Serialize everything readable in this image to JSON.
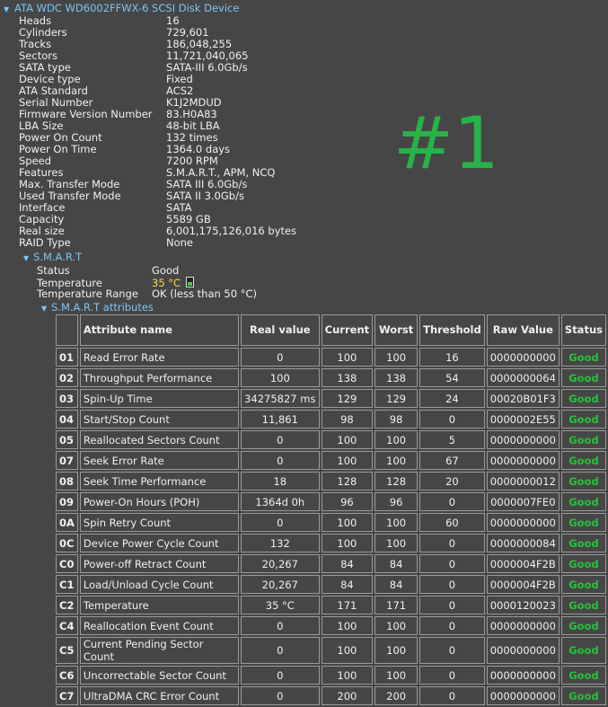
{
  "device": {
    "title": "ATA WDC WD6002FFWX-6 SCSI Disk Device"
  },
  "properties": [
    {
      "key": "Heads",
      "value": "16"
    },
    {
      "key": "Cylinders",
      "value": "729,601"
    },
    {
      "key": "Tracks",
      "value": "186,048,255"
    },
    {
      "key": "Sectors",
      "value": "11,721,040,065"
    },
    {
      "key": "SATA type",
      "value": "SATA-III 6.0Gb/s"
    },
    {
      "key": "Device type",
      "value": "Fixed"
    },
    {
      "key": "ATA Standard",
      "value": "ACS2"
    },
    {
      "key": "Serial Number",
      "value": "K1J2MDUD"
    },
    {
      "key": "Firmware Version Number",
      "value": "83.H0A83"
    },
    {
      "key": "LBA Size",
      "value": "48-bit LBA"
    },
    {
      "key": "Power On Count",
      "value": "132 times"
    },
    {
      "key": "Power On Time",
      "value": "1364.0 days"
    },
    {
      "key": "Speed",
      "value": "7200 RPM"
    },
    {
      "key": "Features",
      "value": "S.M.A.R.T., APM, NCQ"
    },
    {
      "key": "Max. Transfer Mode",
      "value": "SATA III 6.0Gb/s"
    },
    {
      "key": "Used Transfer Mode",
      "value": "SATA II 3.0Gb/s"
    },
    {
      "key": "Interface",
      "value": "SATA"
    },
    {
      "key": "Capacity",
      "value": "5589 GB"
    },
    {
      "key": "Real size",
      "value": "6,001,175,126,016 bytes"
    },
    {
      "key": "RAID Type",
      "value": "None"
    }
  ],
  "overlay_label": "#1",
  "smart": {
    "title": "S.M.A.R.T",
    "status_key": "Status",
    "status_value": "Good",
    "temperature_key": "Temperature",
    "temperature_value": "35 °C",
    "range_key": "Temperature Range",
    "range_value": "OK (less than 50 °C)",
    "attrs_title": "S.M.A.R.T attributes",
    "columns": {
      "name": "Attribute name",
      "real": "Real value",
      "current": "Current",
      "worst": "Worst",
      "threshold": "Threshold",
      "raw": "Raw Value",
      "status": "Status"
    },
    "rows": [
      {
        "id": "01",
        "name": "Read Error Rate",
        "real": "0",
        "current": "100",
        "worst": "100",
        "threshold": "16",
        "raw": "0000000000",
        "status": "Good"
      },
      {
        "id": "02",
        "name": "Throughput Performance",
        "real": "100",
        "current": "138",
        "worst": "138",
        "threshold": "54",
        "raw": "0000000064",
        "status": "Good"
      },
      {
        "id": "03",
        "name": "Spin-Up Time",
        "real": "34275827 ms",
        "current": "129",
        "worst": "129",
        "threshold": "24",
        "raw": "00020B01F3",
        "status": "Good"
      },
      {
        "id": "04",
        "name": "Start/Stop Count",
        "real": "11,861",
        "current": "98",
        "worst": "98",
        "threshold": "0",
        "raw": "0000002E55",
        "status": "Good"
      },
      {
        "id": "05",
        "name": "Reallocated Sectors Count",
        "real": "0",
        "current": "100",
        "worst": "100",
        "threshold": "5",
        "raw": "0000000000",
        "status": "Good"
      },
      {
        "id": "07",
        "name": "Seek Error Rate",
        "real": "0",
        "current": "100",
        "worst": "100",
        "threshold": "67",
        "raw": "0000000000",
        "status": "Good"
      },
      {
        "id": "08",
        "name": "Seek Time Performance",
        "real": "18",
        "current": "128",
        "worst": "128",
        "threshold": "20",
        "raw": "0000000012",
        "status": "Good"
      },
      {
        "id": "09",
        "name": "Power-On Hours (POH)",
        "real": "1364d 0h",
        "current": "96",
        "worst": "96",
        "threshold": "0",
        "raw": "0000007FE0",
        "status": "Good"
      },
      {
        "id": "0A",
        "name": "Spin Retry Count",
        "real": "0",
        "current": "100",
        "worst": "100",
        "threshold": "60",
        "raw": "0000000000",
        "status": "Good"
      },
      {
        "id": "0C",
        "name": "Device Power Cycle Count",
        "real": "132",
        "current": "100",
        "worst": "100",
        "threshold": "0",
        "raw": "0000000084",
        "status": "Good"
      },
      {
        "id": "C0",
        "name": "Power-off Retract Count",
        "real": "20,267",
        "current": "84",
        "worst": "84",
        "threshold": "0",
        "raw": "0000004F2B",
        "status": "Good"
      },
      {
        "id": "C1",
        "name": "Load/Unload Cycle Count",
        "real": "20,267",
        "current": "84",
        "worst": "84",
        "threshold": "0",
        "raw": "0000004F2B",
        "status": "Good"
      },
      {
        "id": "C2",
        "name": "Temperature",
        "real": "35 °C",
        "current": "171",
        "worst": "171",
        "threshold": "0",
        "raw": "0000120023",
        "status": "Good"
      },
      {
        "id": "C4",
        "name": "Reallocation Event Count",
        "real": "0",
        "current": "100",
        "worst": "100",
        "threshold": "0",
        "raw": "0000000000",
        "status": "Good"
      },
      {
        "id": "C5",
        "name": "Current Pending Sector Count",
        "real": "0",
        "current": "100",
        "worst": "100",
        "threshold": "0",
        "raw": "0000000000",
        "status": "Good"
      },
      {
        "id": "C6",
        "name": "Uncorrectable Sector Count",
        "real": "0",
        "current": "100",
        "worst": "100",
        "threshold": "0",
        "raw": "0000000000",
        "status": "Good"
      },
      {
        "id": "C7",
        "name": "UltraDMA CRC Error Count",
        "real": "0",
        "current": "200",
        "worst": "200",
        "threshold": "0",
        "raw": "0000000000",
        "status": "Good"
      }
    ]
  },
  "colors": {
    "background": "#464646",
    "link": "#7ec4f5",
    "good": "#27c23a",
    "overlay": "#27b24a",
    "temperature": "#ffd64a"
  }
}
